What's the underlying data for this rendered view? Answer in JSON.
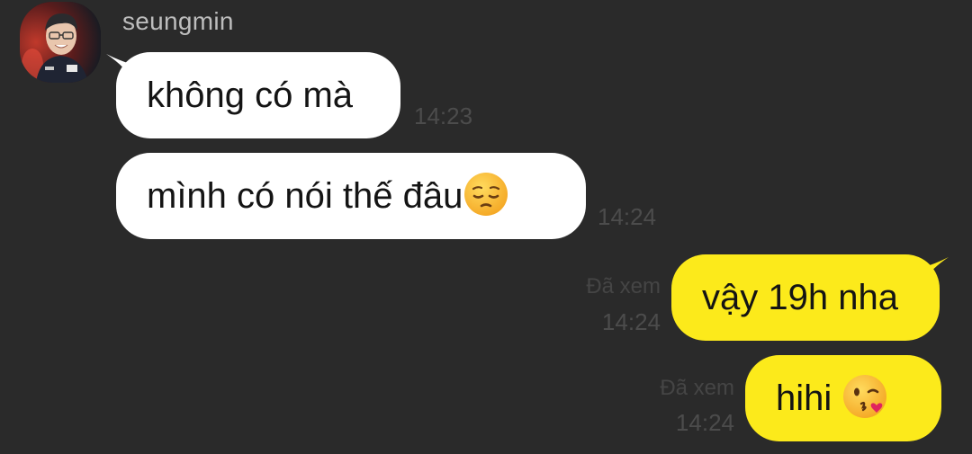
{
  "chat": {
    "sender_name": "seungmin",
    "avatar_icon": "profile-photo",
    "messages": [
      {
        "direction": "incoming",
        "text": "không có mà",
        "time": "14:23"
      },
      {
        "direction": "incoming",
        "text": "mình có nói thế đâu",
        "emoji": "pensive-face-icon",
        "time": "14:24"
      },
      {
        "direction": "outgoing",
        "text": "vậy 19h nha",
        "status": "Đã xem",
        "time": "14:24"
      },
      {
        "direction": "outgoing",
        "text": "hihi",
        "emoji": "face-blowing-kiss-icon",
        "status": "Đã xem",
        "time": "14:24"
      }
    ]
  },
  "colors": {
    "background": "#2a2a2a",
    "incoming_bubble": "#ffffff",
    "outgoing_bubble": "#fcea1b",
    "timestamp": "#4c4c4c",
    "sender_name": "#bdbdbd"
  }
}
